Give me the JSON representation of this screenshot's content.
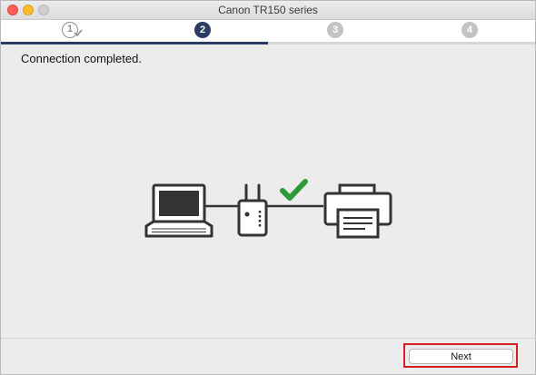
{
  "window": {
    "title": "Canon TR150 series"
  },
  "steps": [
    {
      "label": "1",
      "state": "completed"
    },
    {
      "label": "2",
      "state": "current"
    },
    {
      "label": "3",
      "state": "upcoming"
    },
    {
      "label": "4",
      "state": "upcoming"
    }
  ],
  "main": {
    "message": "Connection completed."
  },
  "illustration": {
    "icons": [
      "laptop-icon",
      "router-icon",
      "checkmark-icon",
      "printer-icon"
    ]
  },
  "footer": {
    "next_label": "Next"
  },
  "colors": {
    "accent": "#2c3b63",
    "check": "#2e9a37",
    "highlight": "#d32020",
    "close": "#fc5f57",
    "minimize": "#fdbc2e"
  }
}
